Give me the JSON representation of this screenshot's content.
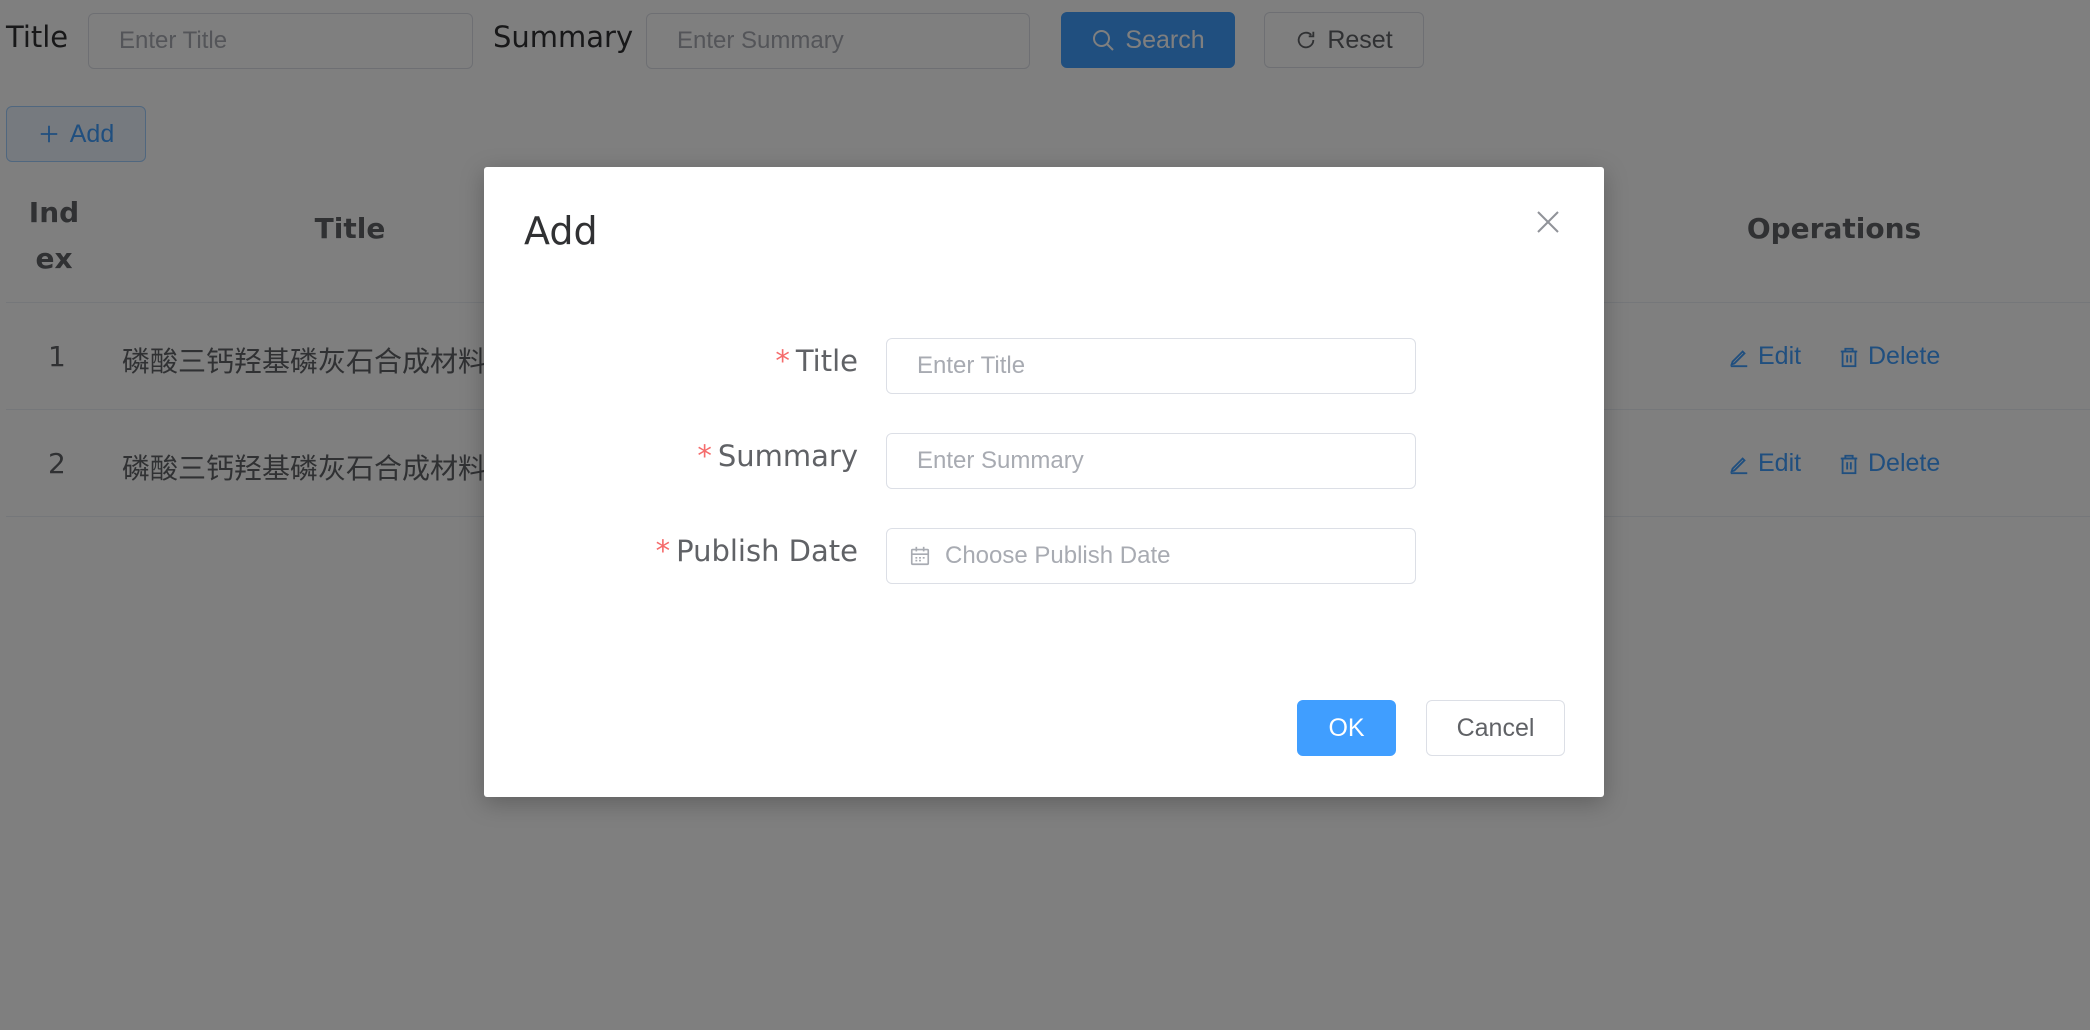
{
  "search": {
    "title_label": "Title",
    "title_placeholder": "Enter Title",
    "summary_label": "Summary",
    "summary_placeholder": "Enter Summary",
    "search_button": "Search",
    "reset_button": "Reset"
  },
  "toolbar": {
    "add_button": "Add"
  },
  "table": {
    "columns": {
      "index": "Index",
      "title": "Title",
      "operations": "Operations"
    },
    "rows": [
      {
        "index": "1",
        "title": "磷酸三钙羟基磷灰石合成材料"
      },
      {
        "index": "2",
        "title": "磷酸三钙羟基磷灰石合成材料"
      }
    ],
    "edit_label": "Edit",
    "delete_label": "Delete"
  },
  "dialog": {
    "title": "Add",
    "required_mark": "*",
    "fields": {
      "title_label": "Title",
      "title_placeholder": "Enter Title",
      "summary_label": "Summary",
      "summary_placeholder": "Enter Summary",
      "date_label": "Publish Date",
      "date_placeholder": "Choose Publish Date"
    },
    "ok_button": "OK",
    "cancel_button": "Cancel"
  },
  "colors": {
    "primary": "#409eff",
    "required": "#f56c6c",
    "overlay": "rgba(0,0,0,0.5)"
  }
}
